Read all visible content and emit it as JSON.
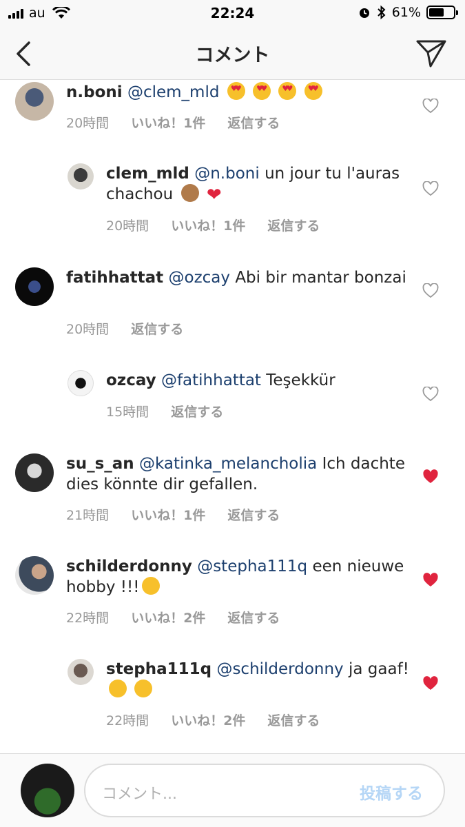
{
  "status_bar": {
    "carrier": "au",
    "time": "22:24",
    "battery_text": "61%",
    "battery_level": 0.61
  },
  "nav": {
    "title": "コメント"
  },
  "comments": [
    {
      "username": "n.boni",
      "mention": "@clem_mld",
      "text": "",
      "emojis": [
        "heart-eyes",
        "heart-eyes",
        "heart-eyes",
        "heart-eyes"
      ],
      "time": "20時間",
      "likes": "いいね！1件",
      "reply": "返信する",
      "liked": false,
      "reply_level": 0
    },
    {
      "username": "clem_mld",
      "mention": "@n.boni",
      "text": "un jour tu l'auras chachou",
      "emojis": [
        "see-no-evil-monkey",
        "red-heart"
      ],
      "time": "20時間",
      "likes": "いいね！1件",
      "reply": "返信する",
      "liked": false,
      "reply_level": 1
    },
    {
      "username": "fatihhattat",
      "mention": "@ozcay",
      "text": "Abi bir mantar bonzai",
      "emojis": [],
      "time": "20時間",
      "likes": "",
      "reply": "返信する",
      "liked": false,
      "reply_level": 0
    },
    {
      "username": "ozcay",
      "mention": "@fatihhattat",
      "text": "Teşekkür",
      "emojis": [],
      "time": "15時間",
      "likes": "",
      "reply": "返信する",
      "liked": false,
      "reply_level": 1
    },
    {
      "username": "su_s_an",
      "mention": "@katinka_melancholia",
      "text": "Ich dachte dies könnte dir gefallen.",
      "emojis": [],
      "time": "21時間",
      "likes": "いいね！1件",
      "reply": "返信する",
      "liked": true,
      "reply_level": 0
    },
    {
      "username": "schilderdonny",
      "mention": "@stepha111q",
      "text": "een nieuwe hobby !!!",
      "emojis": [
        "winking-tongue"
      ],
      "time": "22時間",
      "likes": "いいね！2件",
      "reply": "返信する",
      "liked": true,
      "reply_level": 0
    },
    {
      "username": "stepha111q",
      "mention": "@schilderdonny",
      "text": "ja gaaf!",
      "emojis": [
        "hugging",
        "hugging"
      ],
      "time": "22時間",
      "likes": "いいね！2件",
      "reply": "返信する",
      "liked": true,
      "reply_level": 1
    }
  ],
  "composer": {
    "placeholder": "コメント...",
    "post_label": "投稿する"
  },
  "colors": {
    "mention": "#1c3f6e",
    "liked_heart": "#e0243e",
    "meta": "#999999",
    "post_disabled": "#b5d6f6"
  }
}
